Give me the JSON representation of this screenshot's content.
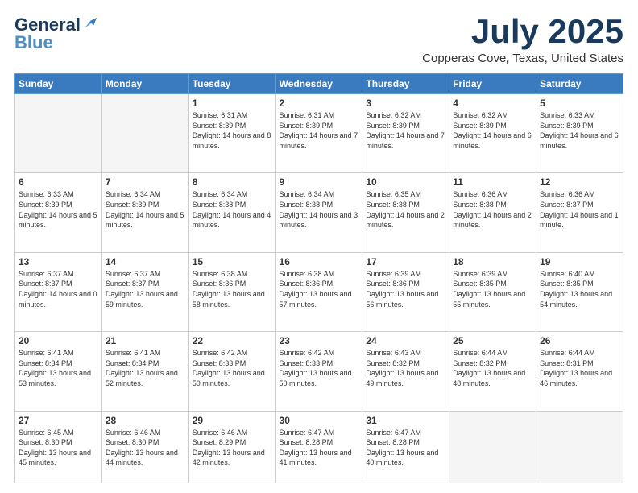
{
  "logo": {
    "line1": "General",
    "line2": "Blue"
  },
  "header": {
    "month": "July 2025",
    "location": "Copperas Cove, Texas, United States"
  },
  "days_of_week": [
    "Sunday",
    "Monday",
    "Tuesday",
    "Wednesday",
    "Thursday",
    "Friday",
    "Saturday"
  ],
  "weeks": [
    [
      {
        "day": "",
        "info": ""
      },
      {
        "day": "",
        "info": ""
      },
      {
        "day": "1",
        "info": "Sunrise: 6:31 AM\nSunset: 8:39 PM\nDaylight: 14 hours and 8 minutes."
      },
      {
        "day": "2",
        "info": "Sunrise: 6:31 AM\nSunset: 8:39 PM\nDaylight: 14 hours and 7 minutes."
      },
      {
        "day": "3",
        "info": "Sunrise: 6:32 AM\nSunset: 8:39 PM\nDaylight: 14 hours and 7 minutes."
      },
      {
        "day": "4",
        "info": "Sunrise: 6:32 AM\nSunset: 8:39 PM\nDaylight: 14 hours and 6 minutes."
      },
      {
        "day": "5",
        "info": "Sunrise: 6:33 AM\nSunset: 8:39 PM\nDaylight: 14 hours and 6 minutes."
      }
    ],
    [
      {
        "day": "6",
        "info": "Sunrise: 6:33 AM\nSunset: 8:39 PM\nDaylight: 14 hours and 5 minutes."
      },
      {
        "day": "7",
        "info": "Sunrise: 6:34 AM\nSunset: 8:39 PM\nDaylight: 14 hours and 5 minutes."
      },
      {
        "day": "8",
        "info": "Sunrise: 6:34 AM\nSunset: 8:38 PM\nDaylight: 14 hours and 4 minutes."
      },
      {
        "day": "9",
        "info": "Sunrise: 6:34 AM\nSunset: 8:38 PM\nDaylight: 14 hours and 3 minutes."
      },
      {
        "day": "10",
        "info": "Sunrise: 6:35 AM\nSunset: 8:38 PM\nDaylight: 14 hours and 2 minutes."
      },
      {
        "day": "11",
        "info": "Sunrise: 6:36 AM\nSunset: 8:38 PM\nDaylight: 14 hours and 2 minutes."
      },
      {
        "day": "12",
        "info": "Sunrise: 6:36 AM\nSunset: 8:37 PM\nDaylight: 14 hours and 1 minute."
      }
    ],
    [
      {
        "day": "13",
        "info": "Sunrise: 6:37 AM\nSunset: 8:37 PM\nDaylight: 14 hours and 0 minutes."
      },
      {
        "day": "14",
        "info": "Sunrise: 6:37 AM\nSunset: 8:37 PM\nDaylight: 13 hours and 59 minutes."
      },
      {
        "day": "15",
        "info": "Sunrise: 6:38 AM\nSunset: 8:36 PM\nDaylight: 13 hours and 58 minutes."
      },
      {
        "day": "16",
        "info": "Sunrise: 6:38 AM\nSunset: 8:36 PM\nDaylight: 13 hours and 57 minutes."
      },
      {
        "day": "17",
        "info": "Sunrise: 6:39 AM\nSunset: 8:36 PM\nDaylight: 13 hours and 56 minutes."
      },
      {
        "day": "18",
        "info": "Sunrise: 6:39 AM\nSunset: 8:35 PM\nDaylight: 13 hours and 55 minutes."
      },
      {
        "day": "19",
        "info": "Sunrise: 6:40 AM\nSunset: 8:35 PM\nDaylight: 13 hours and 54 minutes."
      }
    ],
    [
      {
        "day": "20",
        "info": "Sunrise: 6:41 AM\nSunset: 8:34 PM\nDaylight: 13 hours and 53 minutes."
      },
      {
        "day": "21",
        "info": "Sunrise: 6:41 AM\nSunset: 8:34 PM\nDaylight: 13 hours and 52 minutes."
      },
      {
        "day": "22",
        "info": "Sunrise: 6:42 AM\nSunset: 8:33 PM\nDaylight: 13 hours and 50 minutes."
      },
      {
        "day": "23",
        "info": "Sunrise: 6:42 AM\nSunset: 8:33 PM\nDaylight: 13 hours and 50 minutes."
      },
      {
        "day": "24",
        "info": "Sunrise: 6:43 AM\nSunset: 8:32 PM\nDaylight: 13 hours and 49 minutes."
      },
      {
        "day": "25",
        "info": "Sunrise: 6:44 AM\nSunset: 8:32 PM\nDaylight: 13 hours and 48 minutes."
      },
      {
        "day": "26",
        "info": "Sunrise: 6:44 AM\nSunset: 8:31 PM\nDaylight: 13 hours and 46 minutes."
      }
    ],
    [
      {
        "day": "27",
        "info": "Sunrise: 6:45 AM\nSunset: 8:30 PM\nDaylight: 13 hours and 45 minutes."
      },
      {
        "day": "28",
        "info": "Sunrise: 6:46 AM\nSunset: 8:30 PM\nDaylight: 13 hours and 44 minutes."
      },
      {
        "day": "29",
        "info": "Sunrise: 6:46 AM\nSunset: 8:29 PM\nDaylight: 13 hours and 42 minutes."
      },
      {
        "day": "30",
        "info": "Sunrise: 6:47 AM\nSunset: 8:28 PM\nDaylight: 13 hours and 41 minutes."
      },
      {
        "day": "31",
        "info": "Sunrise: 6:47 AM\nSunset: 8:28 PM\nDaylight: 13 hours and 40 minutes."
      },
      {
        "day": "",
        "info": ""
      },
      {
        "day": "",
        "info": ""
      }
    ]
  ]
}
